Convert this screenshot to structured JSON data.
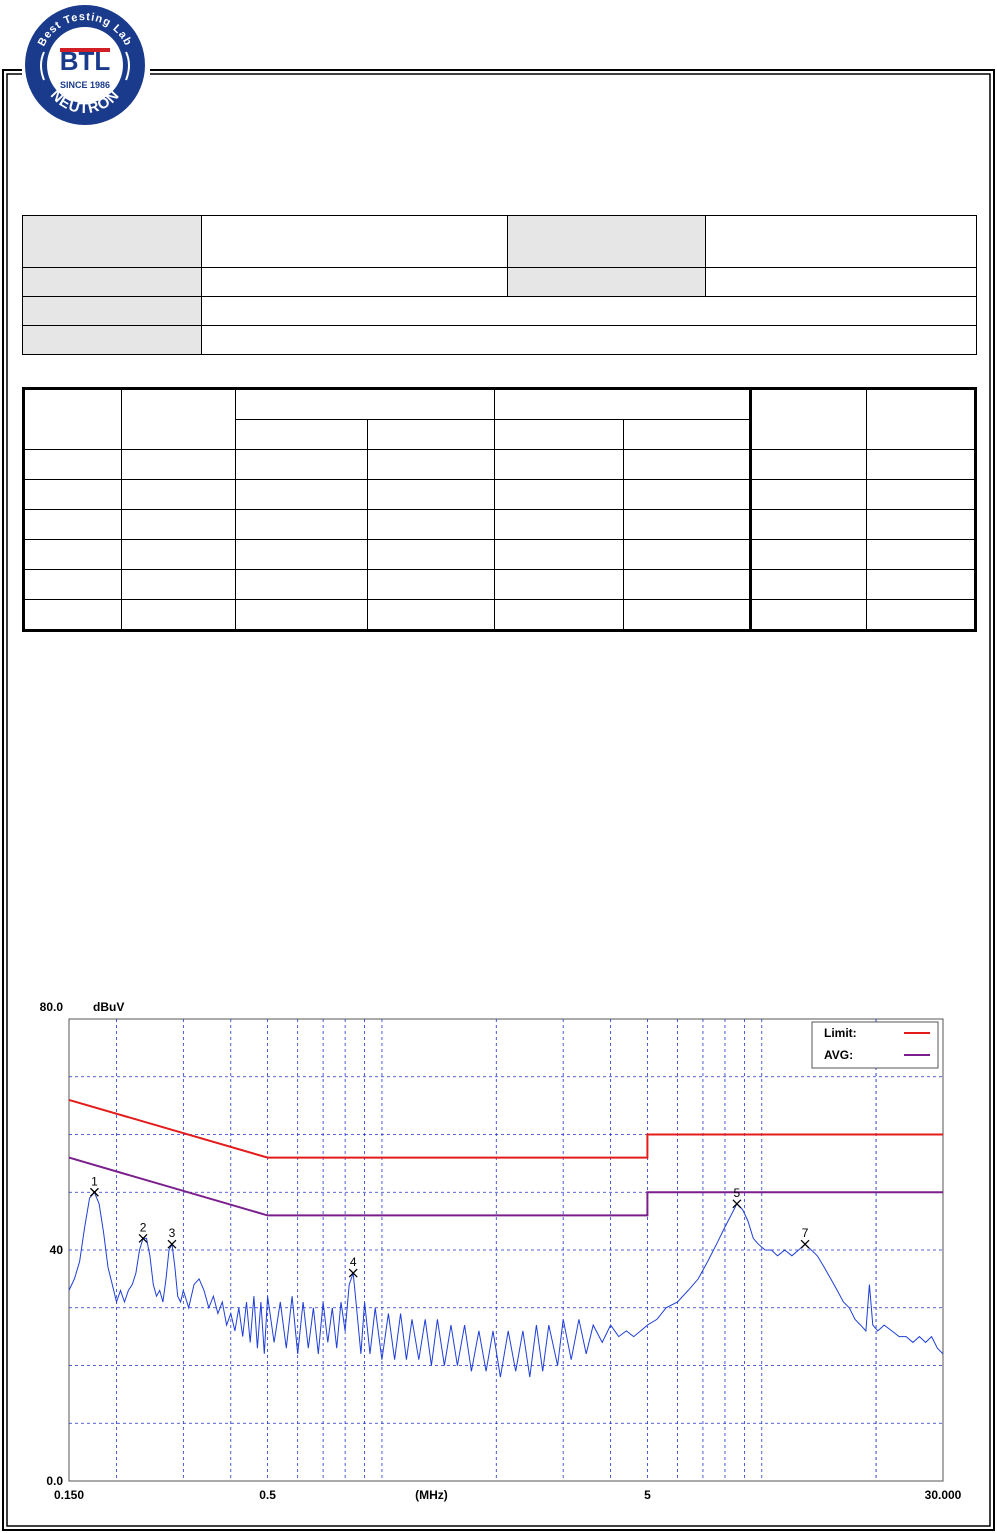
{
  "logo": {
    "ring_text": "Best Testing Lab",
    "brand": "BTL",
    "since": "SINCE 1986",
    "name": "NEUTRON",
    "colors": {
      "ring": "#1a3a8c",
      "inner": "#ffffff",
      "accent": "#d21f26"
    }
  },
  "chart_data": {
    "type": "line",
    "title": "",
    "ylabel_unit": "dBuV",
    "xlabel": "(MHz)",
    "x_scale": "log",
    "xlim": [
      0.15,
      30
    ],
    "ylim": [
      0,
      80
    ],
    "x_tick_labels": [
      {
        "x": 0.15,
        "label": "0.150"
      },
      {
        "x": 0.5,
        "label": "0.5"
      },
      {
        "x": 5,
        "label": "5"
      },
      {
        "x": 30,
        "label": "30.000"
      }
    ],
    "y_tick_labels": [
      {
        "y": 80,
        "label": "80.0"
      },
      {
        "y": 40,
        "label": "40"
      },
      {
        "y": 0,
        "label": "0.0"
      }
    ],
    "grid": true,
    "legend_position": "top-right",
    "legend": [
      {
        "name": "Limit:",
        "color": "#e31b1b"
      },
      {
        "name": "AVG:",
        "color": "#7a1e8c"
      }
    ],
    "series": [
      {
        "name": "Limit:",
        "color": "#e31b1b",
        "points": [
          [
            0.15,
            66
          ],
          [
            0.5,
            56
          ],
          [
            5,
            56
          ],
          [
            5,
            60
          ],
          [
            30,
            60
          ]
        ]
      },
      {
        "name": "AVG:",
        "color": "#7a1e8c",
        "points": [
          [
            0.15,
            56
          ],
          [
            0.5,
            46
          ],
          [
            5,
            46
          ],
          [
            5,
            50
          ],
          [
            30,
            50
          ]
        ]
      },
      {
        "name": "",
        "color": "#1f3fd6",
        "points": [
          [
            0.15,
            33
          ],
          [
            0.155,
            35
          ],
          [
            0.16,
            38
          ],
          [
            0.165,
            44
          ],
          [
            0.17,
            49
          ],
          [
            0.175,
            50
          ],
          [
            0.18,
            48
          ],
          [
            0.185,
            43
          ],
          [
            0.19,
            37
          ],
          [
            0.195,
            34
          ],
          [
            0.2,
            31
          ],
          [
            0.205,
            33
          ],
          [
            0.21,
            31
          ],
          [
            0.215,
            33
          ],
          [
            0.22,
            34
          ],
          [
            0.225,
            36
          ],
          [
            0.23,
            40
          ],
          [
            0.235,
            42
          ],
          [
            0.24,
            42
          ],
          [
            0.245,
            39
          ],
          [
            0.25,
            34
          ],
          [
            0.255,
            32
          ],
          [
            0.26,
            33
          ],
          [
            0.265,
            31
          ],
          [
            0.27,
            35
          ],
          [
            0.275,
            40
          ],
          [
            0.28,
            41
          ],
          [
            0.285,
            37
          ],
          [
            0.29,
            32
          ],
          [
            0.295,
            31
          ],
          [
            0.3,
            33
          ],
          [
            0.31,
            30
          ],
          [
            0.32,
            34
          ],
          [
            0.33,
            35
          ],
          [
            0.34,
            33
          ],
          [
            0.35,
            30
          ],
          [
            0.36,
            32
          ],
          [
            0.37,
            29
          ],
          [
            0.38,
            31
          ],
          [
            0.39,
            27
          ],
          [
            0.4,
            29
          ],
          [
            0.41,
            26
          ],
          [
            0.42,
            30
          ],
          [
            0.43,
            25
          ],
          [
            0.44,
            31
          ],
          [
            0.45,
            24
          ],
          [
            0.46,
            32
          ],
          [
            0.47,
            23
          ],
          [
            0.48,
            31
          ],
          [
            0.49,
            22
          ],
          [
            0.5,
            32
          ],
          [
            0.52,
            24
          ],
          [
            0.54,
            31
          ],
          [
            0.56,
            23
          ],
          [
            0.58,
            32
          ],
          [
            0.6,
            22
          ],
          [
            0.62,
            31
          ],
          [
            0.64,
            23
          ],
          [
            0.66,
            30
          ],
          [
            0.68,
            22
          ],
          [
            0.7,
            31
          ],
          [
            0.72,
            24
          ],
          [
            0.74,
            30
          ],
          [
            0.76,
            23
          ],
          [
            0.78,
            31
          ],
          [
            0.8,
            26
          ],
          [
            0.82,
            34
          ],
          [
            0.84,
            36
          ],
          [
            0.86,
            29
          ],
          [
            0.88,
            22
          ],
          [
            0.9,
            31
          ],
          [
            0.93,
            22
          ],
          [
            0.96,
            30
          ],
          [
            1.0,
            21
          ],
          [
            1.04,
            29
          ],
          [
            1.08,
            21
          ],
          [
            1.12,
            29
          ],
          [
            1.16,
            21
          ],
          [
            1.2,
            28
          ],
          [
            1.25,
            21
          ],
          [
            1.3,
            28
          ],
          [
            1.35,
            20
          ],
          [
            1.4,
            28
          ],
          [
            1.46,
            20
          ],
          [
            1.52,
            27
          ],
          [
            1.58,
            20
          ],
          [
            1.65,
            27
          ],
          [
            1.72,
            19
          ],
          [
            1.8,
            26
          ],
          [
            1.88,
            19
          ],
          [
            1.96,
            26
          ],
          [
            2.05,
            18
          ],
          [
            2.15,
            26
          ],
          [
            2.25,
            19
          ],
          [
            2.35,
            26
          ],
          [
            2.45,
            18
          ],
          [
            2.55,
            27
          ],
          [
            2.65,
            19
          ],
          [
            2.75,
            27
          ],
          [
            2.9,
            20
          ],
          [
            3.0,
            28
          ],
          [
            3.15,
            21
          ],
          [
            3.3,
            28
          ],
          [
            3.45,
            22
          ],
          [
            3.6,
            27
          ],
          [
            3.8,
            24
          ],
          [
            4.0,
            27
          ],
          [
            4.2,
            25
          ],
          [
            4.4,
            26
          ],
          [
            4.6,
            25
          ],
          [
            4.8,
            26
          ],
          [
            5.0,
            27
          ],
          [
            5.3,
            28
          ],
          [
            5.6,
            30
          ],
          [
            6.0,
            31
          ],
          [
            6.4,
            33
          ],
          [
            6.8,
            35
          ],
          [
            7.2,
            38
          ],
          [
            7.6,
            41
          ],
          [
            8.0,
            44
          ],
          [
            8.3,
            46
          ],
          [
            8.6,
            48
          ],
          [
            8.9,
            47
          ],
          [
            9.2,
            45
          ],
          [
            9.5,
            42
          ],
          [
            9.8,
            41
          ],
          [
            10.2,
            40
          ],
          [
            10.6,
            40
          ],
          [
            11.0,
            39
          ],
          [
            11.5,
            40
          ],
          [
            12.0,
            39
          ],
          [
            12.5,
            40
          ],
          [
            13.0,
            41
          ],
          [
            13.5,
            40
          ],
          [
            14.0,
            39
          ],
          [
            14.6,
            37
          ],
          [
            15.2,
            35
          ],
          [
            15.8,
            33
          ],
          [
            16.4,
            31
          ],
          [
            17.0,
            30
          ],
          [
            17.6,
            28
          ],
          [
            18.2,
            27
          ],
          [
            18.8,
            26
          ],
          [
            19.2,
            34
          ],
          [
            19.6,
            27
          ],
          [
            20.2,
            26
          ],
          [
            21.0,
            27
          ],
          [
            22.0,
            26
          ],
          [
            23.0,
            25
          ],
          [
            24.0,
            25
          ],
          [
            25.0,
            24
          ],
          [
            26.0,
            25
          ],
          [
            27.0,
            24
          ],
          [
            28.0,
            25
          ],
          [
            29.0,
            23
          ],
          [
            30.0,
            22
          ]
        ]
      }
    ],
    "markers": [
      {
        "label": "1",
        "x": 0.175,
        "y": 50
      },
      {
        "label": "2",
        "x": 0.235,
        "y": 42
      },
      {
        "label": "3",
        "x": 0.28,
        "y": 41
      },
      {
        "label": "4",
        "x": 0.84,
        "y": 36
      },
      {
        "label": "5",
        "x": 8.6,
        "y": 48
      },
      {
        "label": "7",
        "x": 13.0,
        "y": 41
      }
    ]
  }
}
